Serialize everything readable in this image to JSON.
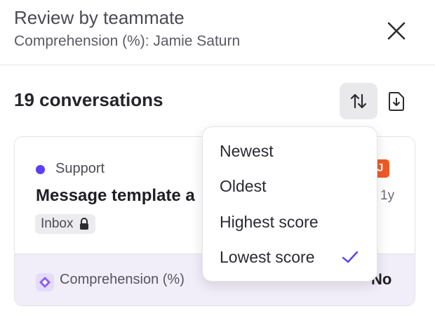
{
  "header": {
    "title": "Review by teammate",
    "subtitle": "Comprehension (%): Jamie Saturn",
    "close_icon": "close-icon"
  },
  "toolbar": {
    "conversation_count": "19 conversations",
    "sort_icon": "sort-arrows-icon",
    "export_icon": "file-download-icon"
  },
  "conversation": {
    "source": "Support",
    "source_color": "#5b3df5",
    "title": "Message template a",
    "tag": "Inbox",
    "tag_icon": "lock-icon",
    "avatar_initial": "J",
    "avatar_color": "#f05a26",
    "time": "1y",
    "criterion_icon": "sparkle-diamond-icon",
    "criterion": "Comprehension (%)",
    "criterion_value": "No"
  },
  "sort_menu": {
    "items": [
      {
        "label": "Newest",
        "selected": false
      },
      {
        "label": "Oldest",
        "selected": false
      },
      {
        "label": "Highest score",
        "selected": false
      },
      {
        "label": "Lowest score",
        "selected": true
      }
    ],
    "check_icon": "checkmark-icon",
    "accent": "#5b3df5"
  }
}
